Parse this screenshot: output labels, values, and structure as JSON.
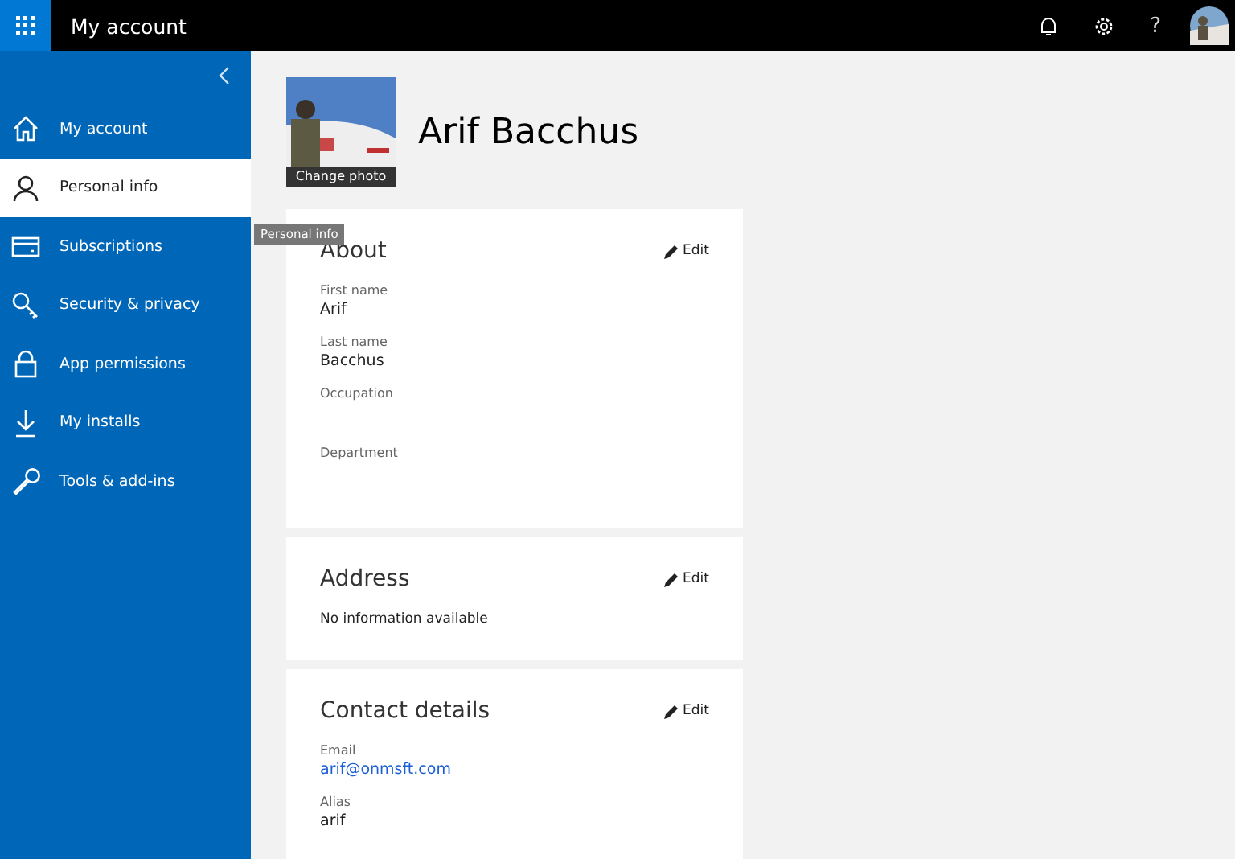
{
  "top_bar": {
    "title": "My account",
    "help": "?"
  },
  "sidebar": {
    "items": [
      {
        "label": "My account",
        "selected": false
      },
      {
        "label": "Personal info",
        "selected": true
      },
      {
        "label": "Subscriptions",
        "selected": false
      },
      {
        "label": "Security & privacy",
        "selected": false
      },
      {
        "label": "App permissions",
        "selected": false
      },
      {
        "label": "My installs",
        "selected": false
      },
      {
        "label": "Tools & add-ins",
        "selected": false
      }
    ]
  },
  "tooltip": "Personal info",
  "profile": {
    "photo_caption": "Change photo",
    "name": "Arif Bacchus"
  },
  "sections": [
    {
      "title": "About",
      "edit": "Edit",
      "kind": "fields",
      "fields": [
        {
          "label": "First name",
          "value": "Arif",
          "kind": "text"
        },
        {
          "label": "Last name",
          "value": "Bacchus",
          "kind": "text"
        },
        {
          "label": "Occupation"
        },
        {
          "label": "Department"
        }
      ]
    },
    {
      "title": "Address",
      "edit": "Edit",
      "kind": "note",
      "note": "No information available"
    },
    {
      "title": "Contact details",
      "edit": "Edit",
      "kind": "fields",
      "fields": [
        {
          "label": "Email",
          "value": "arif@onmsft.com",
          "kind": "link"
        },
        {
          "label": "Alias",
          "value": "arif",
          "kind": "text"
        }
      ]
    }
  ]
}
